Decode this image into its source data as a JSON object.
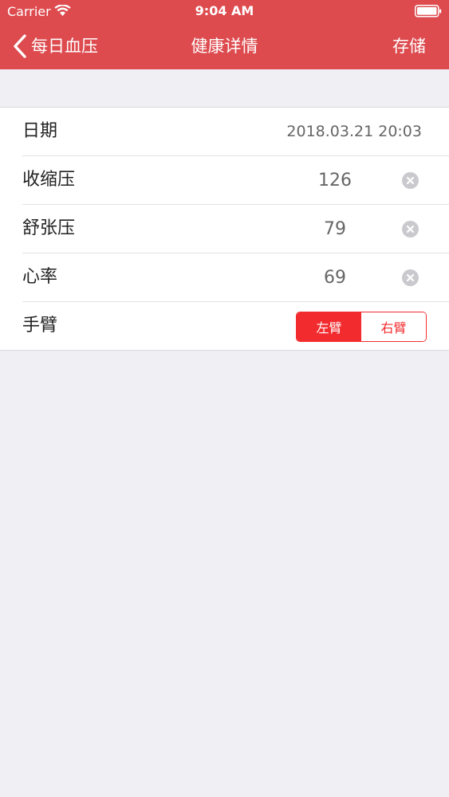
{
  "status_bar": {
    "carrier": "Carrier",
    "time": "9:04 AM",
    "wifi_icon": "wifi-icon",
    "battery_icon": "battery-icon"
  },
  "nav": {
    "back_label": "每日血压",
    "title": "健康详情",
    "save_label": "存储"
  },
  "form": {
    "date": {
      "label": "日期",
      "value": "2018.03.21 20:03"
    },
    "systolic": {
      "label": "收缩压",
      "value": "126"
    },
    "diastolic": {
      "label": "舒张压",
      "value": "79"
    },
    "heart_rate": {
      "label": "心率",
      "value": "69"
    },
    "arm": {
      "label": "手臂",
      "options": [
        "左臂",
        "右臂"
      ],
      "selected": "左臂"
    }
  },
  "colors": {
    "header": "#dd4b4f",
    "accent": "#f22b2f",
    "background": "#efeff4"
  }
}
